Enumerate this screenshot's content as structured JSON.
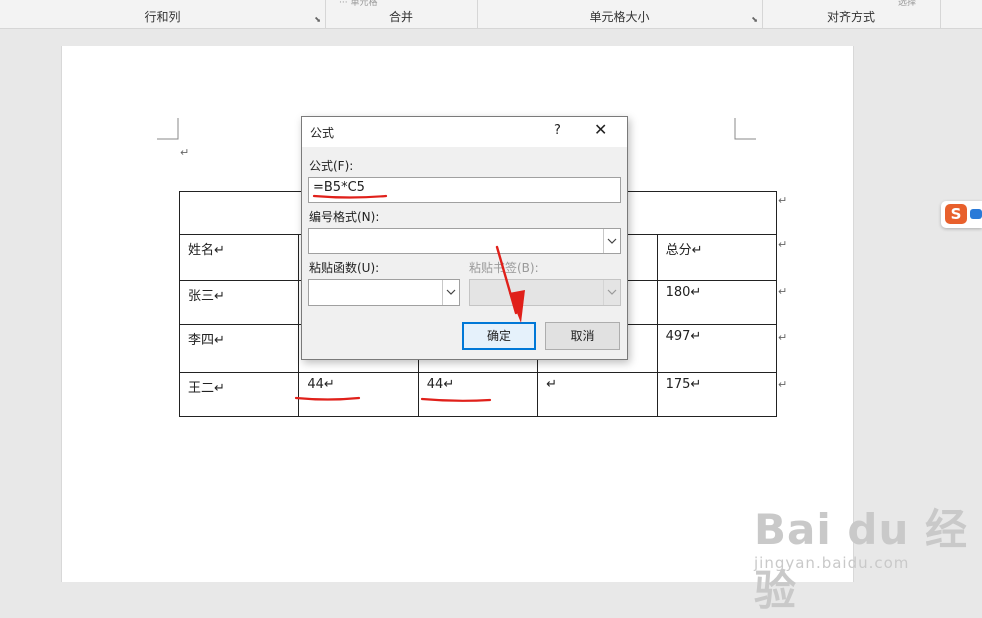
{
  "ribbon": {
    "groups": [
      "行和列",
      "合并",
      "单元格大小",
      "对齐方式"
    ],
    "cut_text_1": "··· 单元格",
    "cut_text_2": "选择"
  },
  "doc": {
    "pilcrow": "↵",
    "table": [
      [
        "",
        "",
        "",
        "",
        ""
      ],
      [
        "姓名↵",
        "",
        "",
        "",
        "总分↵"
      ],
      [
        "张三↵",
        "",
        "",
        "",
        "180↵"
      ],
      [
        "李四↵",
        "",
        "",
        "",
        "497↵"
      ],
      [
        "王二↵",
        "44↵",
        "44↵",
        "↵",
        "175↵"
      ]
    ],
    "row_end": "↵"
  },
  "dialog": {
    "title": "公式",
    "help": "?",
    "close": "✕",
    "formula_label": "公式(F):",
    "formula_value": "=B5*C5",
    "number_format_label": "编号格式(N):",
    "number_format_value": "",
    "paste_function_label": "粘贴函数(U):",
    "paste_bookmark_label": "粘贴书签(B):",
    "ok": "确定",
    "cancel": "取消"
  },
  "sogou": {
    "letter": "S"
  },
  "watermark": {
    "brand": "Bai du 经验",
    "url": "jingyan.baidu.com"
  },
  "colors": {
    "annotation_red": "#e0201a",
    "focus_blue": "#0078d7",
    "sogou_orange": "#e8602c"
  }
}
